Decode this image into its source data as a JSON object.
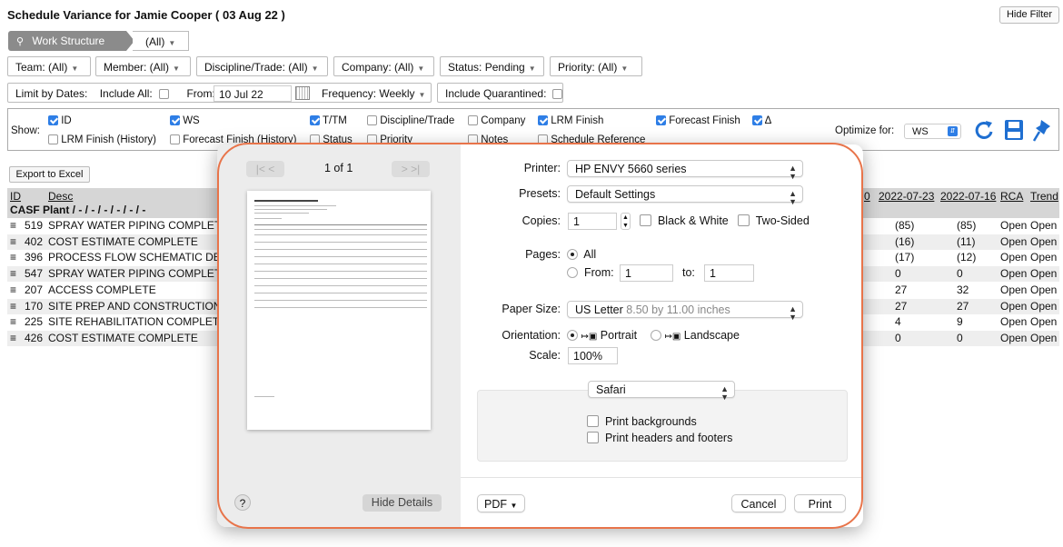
{
  "page": {
    "title": "Schedule Variance for Jamie Cooper ( 03 Aug 22 )",
    "hide_filter": "Hide Filter"
  },
  "filters": {
    "work_structure_label": "Work Structure",
    "work_structure_value": "(All)",
    "team": "Team: (All)",
    "member": "Member: (All)",
    "discipline": "Discipline/Trade: (All)",
    "company": "Company: (All)",
    "status": "Status: Pending",
    "priority": "Priority: (All)",
    "limit_by_dates": "Limit by Dates:",
    "include_all": "Include All:",
    "from_label": "From:",
    "from_value": "10 Jul 22",
    "frequency": "Frequency: Weekly",
    "include_quarantined": "Include Quarantined:"
  },
  "show": {
    "label": "Show:",
    "row1": [
      {
        "label": "ID",
        "checked": true
      },
      {
        "label": "WS",
        "checked": true
      },
      {
        "label": "T/TM",
        "checked": true
      },
      {
        "label": "Discipline/Trade",
        "checked": false
      },
      {
        "label": "Company",
        "checked": false
      },
      {
        "label": "LRM Finish",
        "checked": true
      },
      {
        "label": "Forecast Finish",
        "checked": true
      },
      {
        "label": "Δ",
        "checked": true
      }
    ],
    "row2": [
      {
        "label": "LRM Finish (History)",
        "checked": false
      },
      {
        "label": "Forecast Finish (History)",
        "checked": false
      },
      {
        "label": "Status",
        "checked": false
      },
      {
        "label": "Priority",
        "checked": false
      },
      {
        "label": "Notes",
        "checked": false
      },
      {
        "label": "Schedule Reference",
        "checked": false
      }
    ],
    "optimize_label": "Optimize for:",
    "optimize_value": "WS"
  },
  "export_label": "Export to Excel",
  "grid": {
    "headers": {
      "id": "ID",
      "desc": "Desc",
      "partial": "0",
      "c1": "2022-07-23",
      "c2": "2022-07-16",
      "rca": "RCA",
      "trend": "Trend"
    },
    "group": "CASF Plant / - / - / - / - / - / -",
    "rows": [
      {
        "id": "519",
        "desc": "SPRAY WATER PIPING COMPLETE",
        "c1": "(85)",
        "c2": "(85)",
        "rca": "Open",
        "trend": "Open"
      },
      {
        "id": "402",
        "desc": "COST ESTIMATE COMPLETE",
        "c1": "(16)",
        "c2": "(11)",
        "rca": "Open",
        "trend": "Open"
      },
      {
        "id": "396",
        "desc": "PROCESS FLOW SCHEMATIC DEVELO",
        "c1": "(17)",
        "c2": "(12)",
        "rca": "Open",
        "trend": "Open"
      },
      {
        "id": "547",
        "desc": "SPRAY WATER PIPING COMPLETE",
        "c1": "0",
        "c2": "0",
        "rca": "Open",
        "trend": "Open"
      },
      {
        "id": "207",
        "desc": "ACCESS COMPLETE",
        "c1": "27",
        "c2": "32",
        "rca": "Open",
        "trend": "Open"
      },
      {
        "id": "170",
        "desc": "SITE PREP AND CONSTRUCTION CO",
        "c1": "27",
        "c2": "27",
        "rca": "Open",
        "trend": "Open"
      },
      {
        "id": "225",
        "desc": "SITE REHABILITATION COMPLETE",
        "c1": "4",
        "c2": "9",
        "rca": "Open",
        "trend": "Open"
      },
      {
        "id": "426",
        "desc": "COST ESTIMATE COMPLETE",
        "c1": "0",
        "c2": "0",
        "rca": "Open",
        "trend": "Open"
      }
    ]
  },
  "print": {
    "page_indicator": "1 of 1",
    "printer_label": "Printer:",
    "printer_value": "HP ENVY 5660 series",
    "presets_label": "Presets:",
    "presets_value": "Default Settings",
    "copies_label": "Copies:",
    "copies_value": "1",
    "bw_label": "Black & White",
    "two_sided_label": "Two-Sided",
    "pages_label": "Pages:",
    "pages_all": "All",
    "pages_from": "From:",
    "pages_from_value": "1",
    "pages_to": "to:",
    "pages_to_value": "1",
    "paper_label": "Paper Size:",
    "paper_value": "US Letter",
    "paper_dims": "8.50 by 11.00 inches",
    "orientation_label": "Orientation:",
    "portrait": "Portrait",
    "landscape": "Landscape",
    "scale_label": "Scale:",
    "scale_value": "100%",
    "app_select": "Safari",
    "print_backgrounds": "Print backgrounds",
    "print_headers": "Print headers and footers",
    "help": "?",
    "hide_details": "Hide Details",
    "pdf": "PDF",
    "cancel": "Cancel",
    "print": "Print"
  }
}
